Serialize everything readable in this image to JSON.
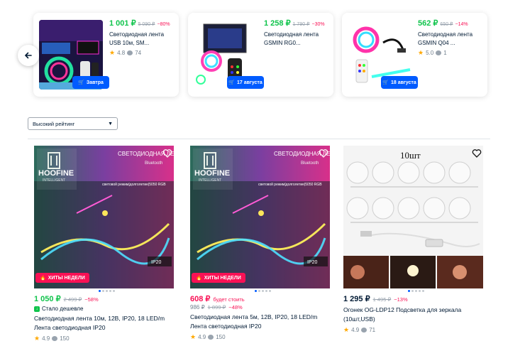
{
  "carousel": {
    "prev_label": "←",
    "items": [
      {
        "price": "1 001 ₽",
        "old_price": "5 090 ₽",
        "discount": "−80%",
        "title": "Светодиодная лента USB 10м, SM...",
        "rating": "4.8",
        "reviews": "74",
        "delivery": "Завтра"
      },
      {
        "price": "1 258 ₽",
        "old_price": "1 790 ₽",
        "discount": "−30%",
        "title": "Светодиодная лента GSMIN RG0...",
        "rating": "",
        "reviews": "",
        "delivery": "17 августа"
      },
      {
        "price": "562 ₽",
        "old_price": "650 ₽",
        "discount": "−14%",
        "title": "Светодиодная лента GSMIN Q04 ...",
        "rating": "5.0",
        "reviews": "1",
        "delivery": "18 августа"
      }
    ]
  },
  "sort": {
    "value": "Высокий рейтинг"
  },
  "products": [
    {
      "brand": "HOOFINE",
      "brand_sub": "INTELLIGENT",
      "box_title": "СВЕТОДИОДНАЯ ЛЕНТА",
      "box_sub": "Bluetooth",
      "box_text": "световой режим|долголетие|5050 RGB",
      "ip": "IP20",
      "badge": "ХИТЫ НЕДЕЛИ",
      "price": "1 050 ₽",
      "old_price": "2 499 ₽",
      "discount": "−58%",
      "cheaper": "Стало дешевле",
      "title": "Светодиодная лента 10м, 12В, IP20, 18 LED/m Лента светодиодная IP20",
      "rating": "4.9",
      "reviews": "150"
    },
    {
      "brand": "HOOFINE",
      "brand_sub": "INTELLIGENT",
      "box_title": "СВЕТОДИОДНАЯ ЛЕНТ",
      "box_sub": "Bluetooth",
      "box_text": "световой режим|долголетие|5050 RGB",
      "ip": "IP20",
      "badge": "ХИТЫ НЕДЕЛИ",
      "price": "608 ₽",
      "price_note": "будет стоить",
      "old_price": "986 ₽",
      "old_price2": "1 899 ₽",
      "discount": "−48%",
      "title": "Светодиодная лента 5м, 12В, IP20, 18 LED/m Лента светодиодная IP20",
      "rating": "4.9",
      "reviews": "150"
    },
    {
      "box_label": "10шт",
      "price": "1 295 ₽",
      "old_price": "1 495 ₽",
      "discount": "−13%",
      "title": "Огонек OG-LDP12 Подсветка для зеркала (10шт,USB)",
      "rating": "4.9",
      "reviews": "71"
    }
  ]
}
